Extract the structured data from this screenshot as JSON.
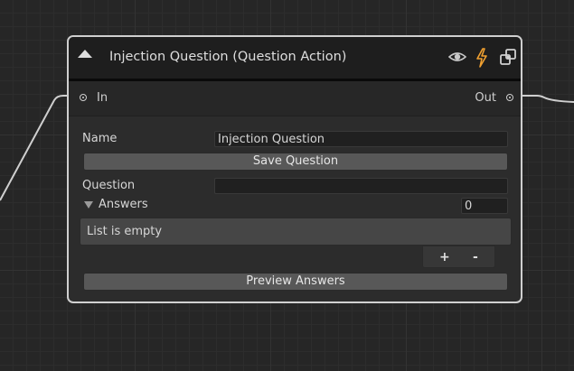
{
  "node": {
    "title": "Injection Question (Question Action)",
    "header_icons": [
      "eye-icon",
      "lightning-icon",
      "node-settings-icon"
    ],
    "accent_color": "#f0a030",
    "ports": {
      "input_label": "In",
      "output_label": "Out"
    },
    "fields": {
      "name_label": "Name",
      "name_value": "Injection Question",
      "save_button": "Save Question",
      "question_label": "Question",
      "question_value": "",
      "answers_label": "Answers",
      "answers_count": "0",
      "list_empty_text": "List is empty",
      "add_symbol": "+",
      "remove_symbol": "-",
      "preview_button": "Preview Answers"
    }
  }
}
